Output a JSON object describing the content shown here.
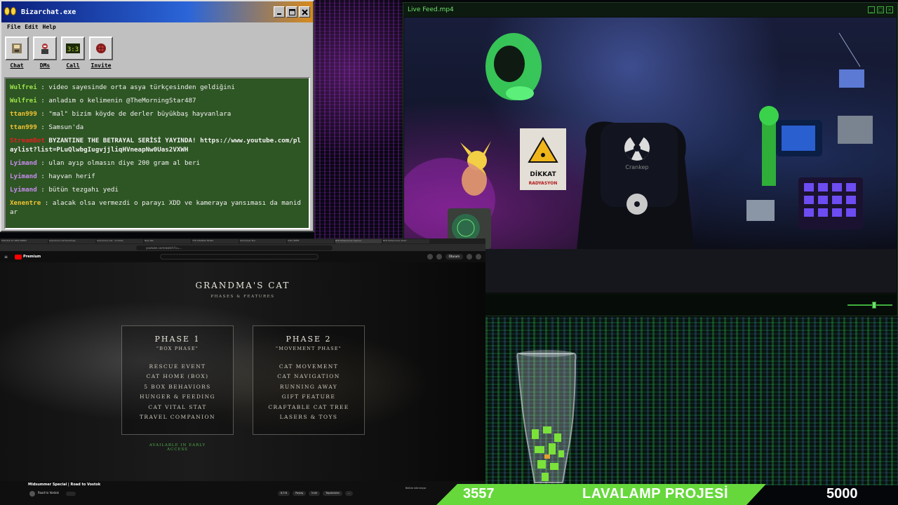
{
  "bizarchat": {
    "title": "Bizarchat.exe",
    "menu": [
      "File",
      "Edit",
      "Help"
    ],
    "tools": [
      {
        "label": "Chat",
        "icon": "chat-icon"
      },
      {
        "label": "DMs",
        "icon": "dms-icon"
      },
      {
        "label": "Call",
        "icon": "call-icon"
      },
      {
        "label": "Invite",
        "icon": "invite-icon"
      }
    ],
    "messages": [
      {
        "user": "Wulfrei",
        "color": "#9be34a",
        "text": "video sayesinde orta asya türkçesinden geldiğini"
      },
      {
        "user": "Wulfrei",
        "color": "#9be34a",
        "text": "anladım o kelimenin @TheMorningStar487"
      },
      {
        "user": "ttan999",
        "color": "#f1c232",
        "text": "\"mal\" bizim köyde de derler büyükbaş hayvanlara"
      },
      {
        "user": "ttan999",
        "color": "#f1c232",
        "text": "Samsun'da"
      },
      {
        "user": "StreamBot",
        "color": "#e02020",
        "text": "BYZANTINE THE BETRAYAL SERİSİ YAYINDA! https://www.youtube.com/playlist?list=PLuQlwbgIugvjjliqHVneapNw0Uas2VXWH",
        "bold": true
      },
      {
        "user": "Lyimand",
        "color": "#c98cf0",
        "text": "ulan ayıp olmasın diye 200 gram al beri"
      },
      {
        "user": "Lyimand",
        "color": "#c98cf0",
        "text": "hayvan herif"
      },
      {
        "user": "Lyimand",
        "color": "#c98cf0",
        "text": "bütün tezgahı yedi"
      },
      {
        "user": "Xenentre",
        "color": "#f1c232",
        "text": "alacak olsa vermezdi o parayı XDD ve kameraya yansıması da manidar"
      }
    ]
  },
  "live_feed": {
    "title": "Live Feed.mp4",
    "play_icon": "play-icon",
    "sign_label": "DİKKAT",
    "sign_sub": "RADYASYON",
    "shirt_text": "Crankep",
    "volume_level": 0.6
  },
  "browser": {
    "tabs": [
      "ECB DLE 67 NEW REMIX",
      "Grandma's Cat Roadmap",
      "Grandma's Cat - YouTube",
      "New Tab",
      "YTD SHARMA MUSIC",
      "SecurityAI Tour",
      "GTD ÜNİTE",
      "BTD Midsummer Special",
      "BTD Midsummer Road"
    ],
    "url": "youtube.com/watch?v=...",
    "yt_premium": "Premium",
    "yt_signin": "Oturum"
  },
  "game_video": {
    "title": "GRANDMA'S CAT",
    "subtitle": "PHASES & FEATURES",
    "phases": [
      {
        "title": "PHASE 1",
        "sub": "\"BOX PHASE\"",
        "items": [
          "RESCUE EVENT",
          "CAT HOME (BOX)",
          "5 BOX BEHAVIORS",
          "HUNGER & FEEDING",
          "CAT VITAL STAT",
          "TRAVEL COMPANION"
        ]
      },
      {
        "title": "PHASE 2",
        "sub": "\"MOVEMENT PHASE\"",
        "items": [
          "CAT MOVEMENT",
          "CAT NAVIGATION",
          "RUNNING AWAY",
          "GIFT FEATURE",
          "CRAFTABLE CAT TREE",
          "LASERS & TOYS"
        ]
      }
    ],
    "early_access": "AVAILABLE IN EARLY ACCESS"
  },
  "yt_info": {
    "video_title": "Midsummer Special | Road to Vostok",
    "channel": "Road to Vostok",
    "likes": "6,9 B",
    "actions": [
      "Paylaş",
      "İndir",
      "Teşekkürler",
      "..."
    ],
    "note": "Bölüm bilinmiyor"
  },
  "bottom_bar": {
    "current": "3557",
    "label": "LAVALAMP PROJESİ",
    "goal": "5000"
  }
}
